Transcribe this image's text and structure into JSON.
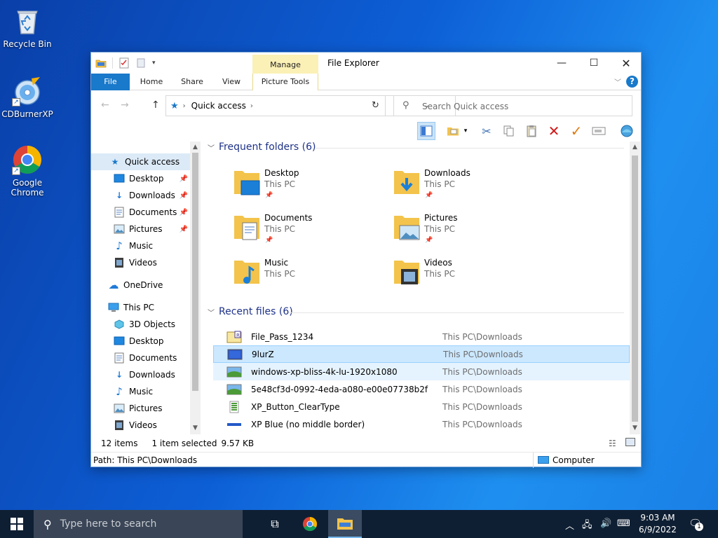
{
  "desktop": {
    "icons": [
      {
        "label": "Recycle Bin",
        "icon": "recycle-bin-icon"
      },
      {
        "label": "CDBurnerXP",
        "icon": "cdburnerxp-icon"
      },
      {
        "label": "Google Chrome",
        "icon": "chrome-icon"
      }
    ]
  },
  "window": {
    "title": "File Explorer",
    "manage_label": "Manage",
    "tabs": {
      "file": "File",
      "home": "Home",
      "share": "Share",
      "view": "View",
      "picture_tools": "Picture Tools"
    },
    "help_label": "?",
    "address": {
      "crumb": "Quick access"
    },
    "search": {
      "placeholder": "Search Quick access"
    }
  },
  "navpane": {
    "quick_access": "Quick access",
    "quick_items": [
      {
        "label": "Desktop",
        "pinned": true
      },
      {
        "label": "Downloads",
        "pinned": true
      },
      {
        "label": "Documents",
        "pinned": true
      },
      {
        "label": "Pictures",
        "pinned": true
      },
      {
        "label": "Music",
        "pinned": false
      },
      {
        "label": "Videos",
        "pinned": false
      }
    ],
    "onedrive": "OneDrive",
    "this_pc": "This PC",
    "pc_items": [
      {
        "label": "3D Objects"
      },
      {
        "label": "Desktop"
      },
      {
        "label": "Documents"
      },
      {
        "label": "Downloads"
      },
      {
        "label": "Music"
      },
      {
        "label": "Pictures"
      },
      {
        "label": "Videos"
      }
    ]
  },
  "content": {
    "frequent_header": "Frequent folders (6)",
    "frequent": [
      {
        "name": "Desktop",
        "location": "This PC"
      },
      {
        "name": "Downloads",
        "location": "This PC"
      },
      {
        "name": "Documents",
        "location": "This PC"
      },
      {
        "name": "Pictures",
        "location": "This PC"
      },
      {
        "name": "Music",
        "location": "This PC"
      },
      {
        "name": "Videos",
        "location": "This PC"
      }
    ],
    "recent_header": "Recent files (6)",
    "recent": [
      {
        "name": "File_Pass_1234",
        "location": "This PC\\Downloads"
      },
      {
        "name": "9lurZ",
        "location": "This PC\\Downloads"
      },
      {
        "name": "windows-xp-bliss-4k-lu-1920x1080",
        "location": "This PC\\Downloads"
      },
      {
        "name": "5e48cf3d-0992-4eda-a080-e00e07738b2f",
        "location": "This PC\\Downloads"
      },
      {
        "name": "XP_Button_ClearType",
        "location": "This PC\\Downloads"
      },
      {
        "name": "XP Blue (no middle border)",
        "location": "This PC\\Downloads"
      }
    ]
  },
  "status": {
    "items": "12 items",
    "selected": "1 item selected",
    "size": "9.57 KB",
    "path": "Path: This PC\\Downloads",
    "computer": "Computer"
  },
  "taskbar": {
    "search_placeholder": "Type here to search",
    "time": "9:03 AM",
    "date": "6/9/2022",
    "notifications": "1"
  }
}
